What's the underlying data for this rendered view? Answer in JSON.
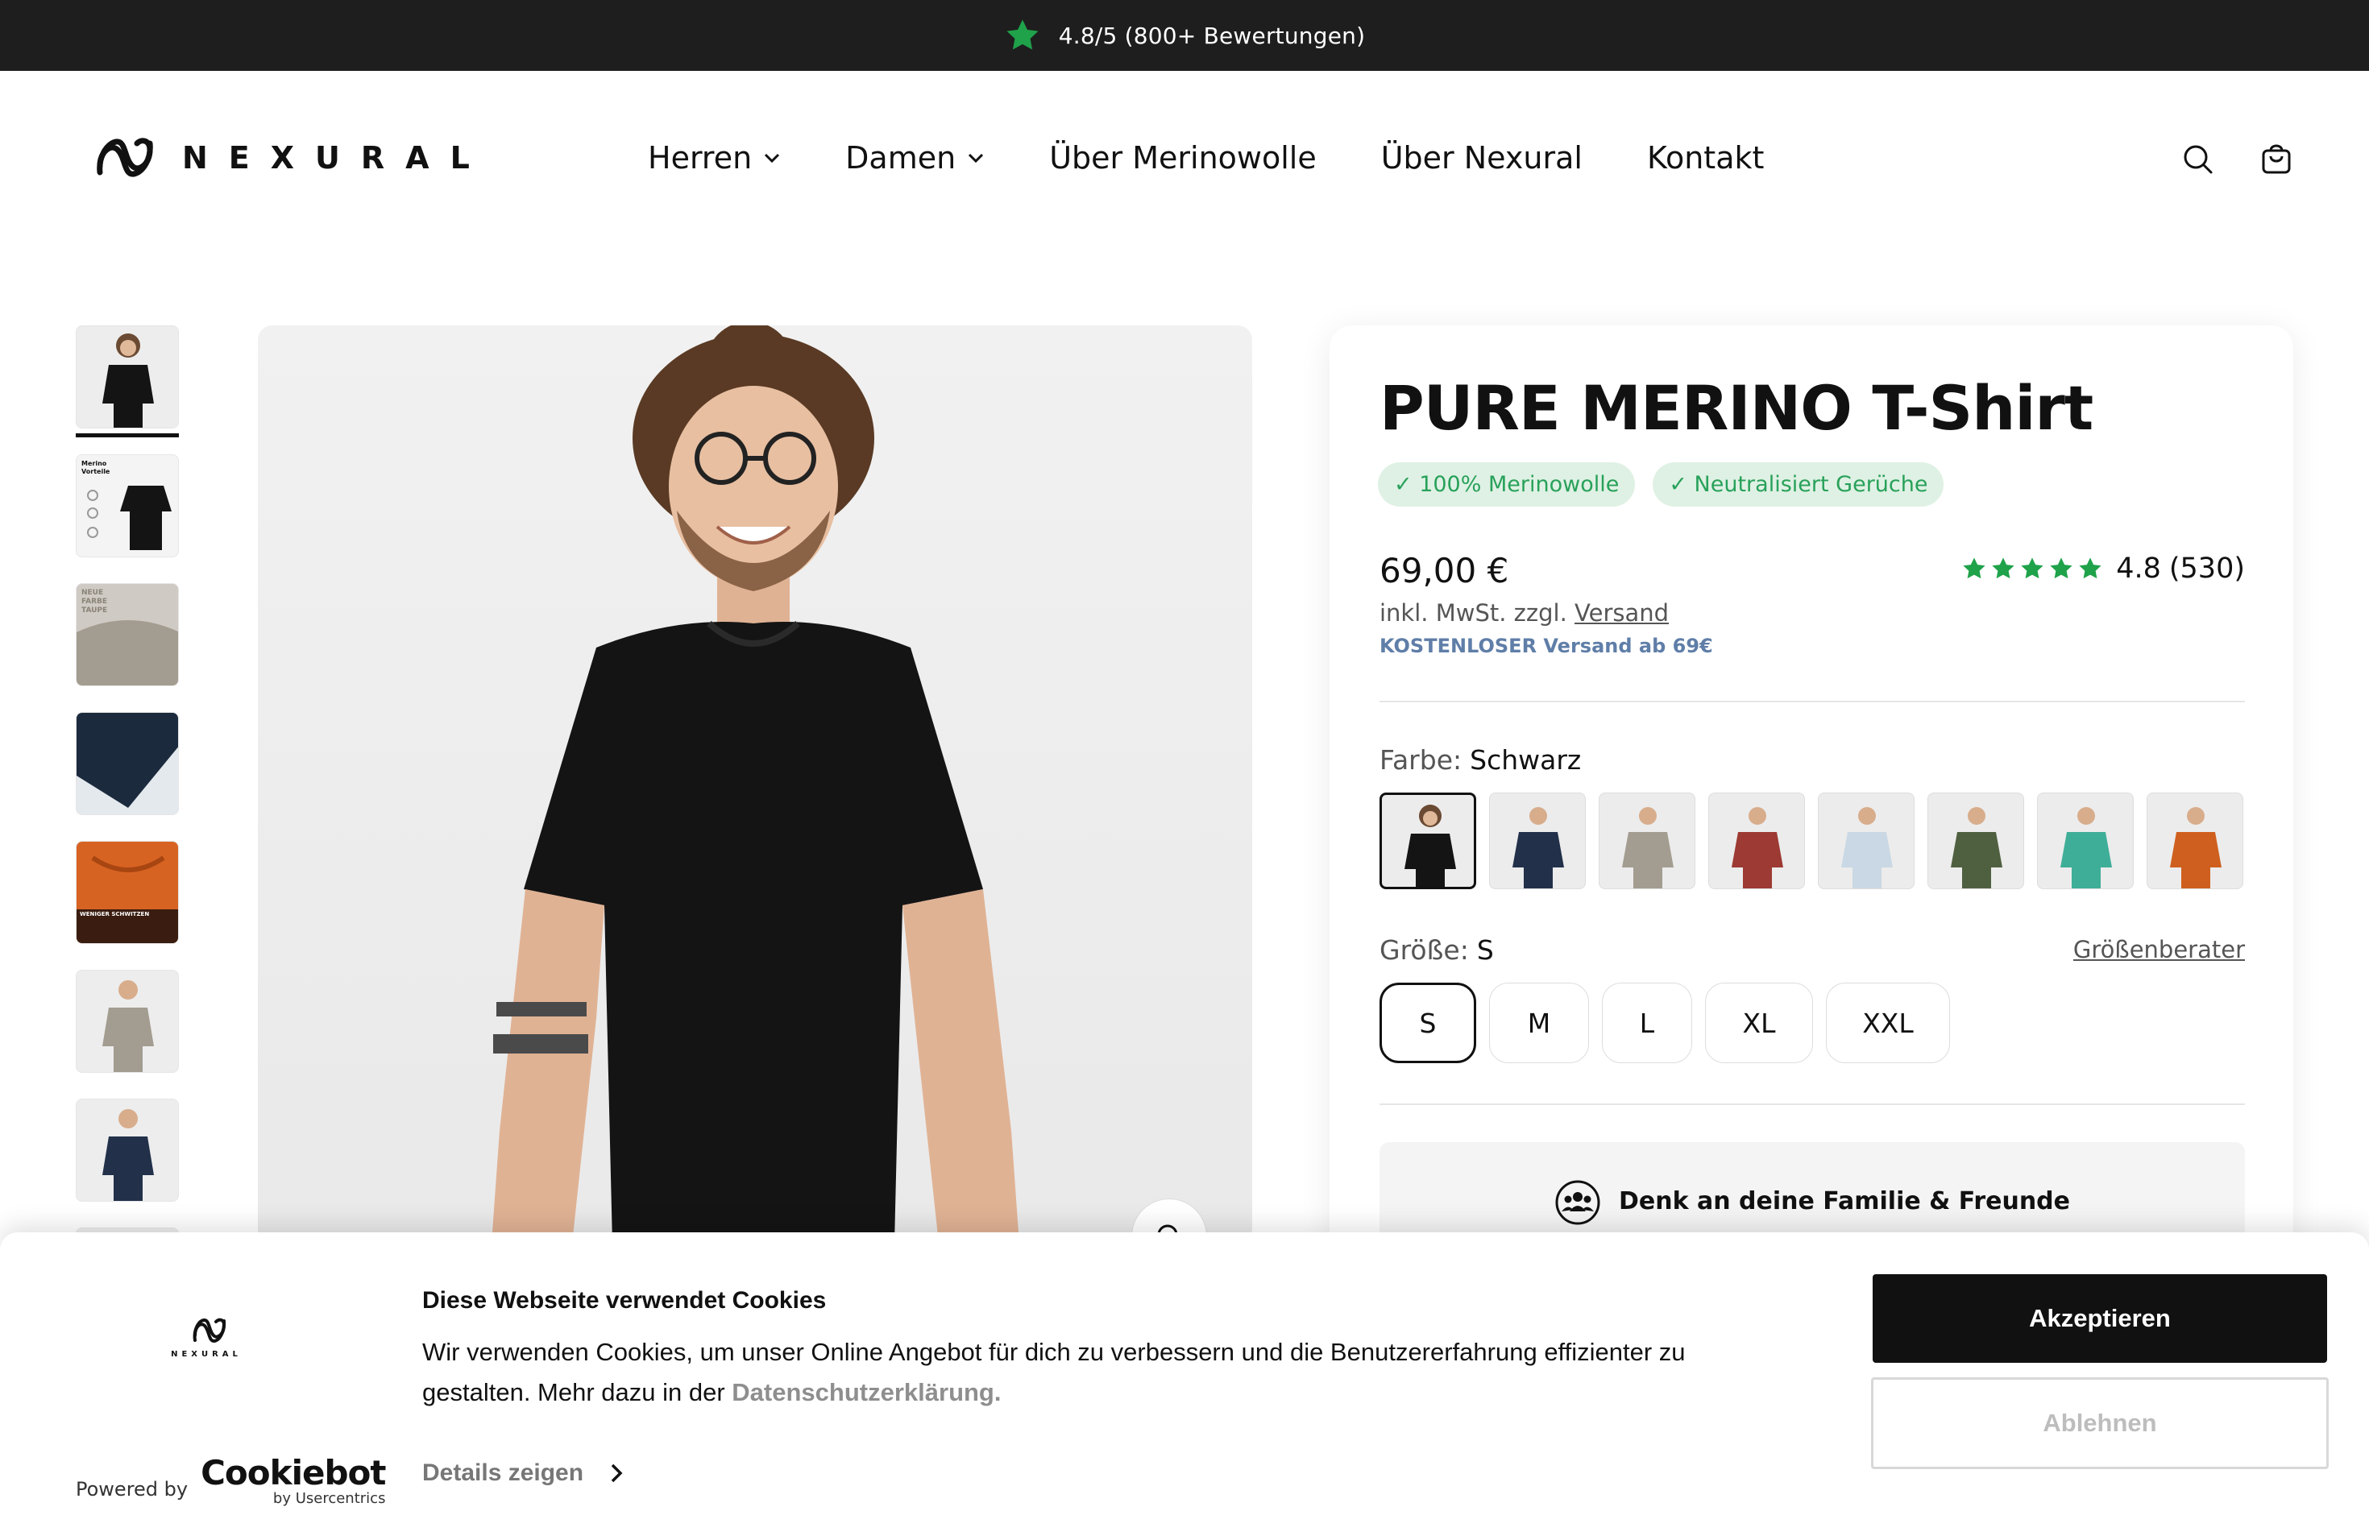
{
  "announcement": {
    "text": "4.8/5 (800+ Bewertungen)",
    "icon": "star-icon",
    "star_color": "#1fa24a"
  },
  "header": {
    "logo_text": "NEXURAL",
    "nav": [
      {
        "label": "Herren",
        "has_dropdown": true
      },
      {
        "label": "Damen",
        "has_dropdown": true
      },
      {
        "label": "Über Merinowolle",
        "has_dropdown": false
      },
      {
        "label": "Über Nexural",
        "has_dropdown": false
      },
      {
        "label": "Kontakt",
        "has_dropdown": false
      }
    ],
    "icons": [
      "search-icon",
      "cart-icon"
    ]
  },
  "gallery": {
    "thumbnail_count": 8,
    "active_index": 0,
    "thumbnail_labels": [
      "",
      "Merino Vorteile",
      "NEUE FARBE TAUPE",
      "",
      "WENIGER SCHWITZEN",
      "",
      "",
      ""
    ]
  },
  "product": {
    "title": "PURE MERINO T-Shirt",
    "badges": [
      "✓ 100% Merinowolle",
      "✓ Neutralisiert Gerüche"
    ],
    "price": "69,00 €",
    "rating": {
      "stars": 5,
      "value": "4.8",
      "count": "(530)",
      "star_color": "#1fa24a"
    },
    "tax_text": "inkl. MwSt. zzgl.",
    "shipping_link": "Versand",
    "free_shipping": "KOSTENLOSER Versand ab 69€",
    "color_label": "Farbe:",
    "color_value": "Schwarz",
    "swatches": [
      {
        "name": "Schwarz",
        "shirt": "#141414",
        "selected": true
      },
      {
        "name": "Navy",
        "shirt": "#22304a",
        "selected": false
      },
      {
        "name": "Taupe",
        "shirt": "#a39c90",
        "selected": false
      },
      {
        "name": "Rot",
        "shirt": "#9c3a33",
        "selected": false
      },
      {
        "name": "Hellblau",
        "shirt": "#c9d8e4",
        "selected": false
      },
      {
        "name": "Olive",
        "shirt": "#4f6040",
        "selected": false
      },
      {
        "name": "Türkis",
        "shirt": "#3fae98",
        "selected": false
      },
      {
        "name": "Orange",
        "shirt": "#cf5f1e",
        "selected": false
      }
    ],
    "size_label": "Größe:",
    "size_value": "S",
    "size_guide": "Größenberater",
    "sizes": [
      {
        "label": "S",
        "selected": true
      },
      {
        "label": "M",
        "selected": false
      },
      {
        "label": "L",
        "selected": false
      },
      {
        "label": "XL",
        "selected": false
      },
      {
        "label": "XXL",
        "selected": false
      }
    ],
    "family_title": "Denk an deine Familie & Freunde"
  },
  "cookie": {
    "title": "Diese Webseite verwendet Cookies",
    "text": "Wir verwenden Cookies, um unser Online Angebot für dich zu verbessern und die Benutzererfahrung effizienter zu gestalten. Mehr dazu in der",
    "privacy_link": "Datenschutzerklärung.",
    "details": "Details zeigen",
    "accept": "Akzeptieren",
    "reject": "Ablehnen",
    "powered_by": "Powered by",
    "brand": "Cookiebot",
    "brand_sub": "by Usercentrics",
    "logo_text": "NEXURAL"
  }
}
